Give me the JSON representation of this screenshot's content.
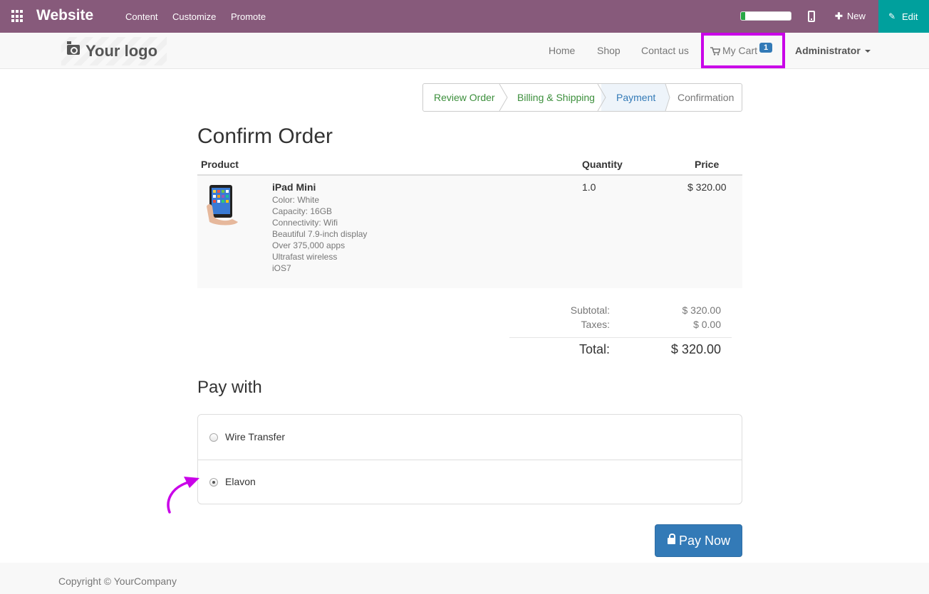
{
  "topbar": {
    "brand": "Website",
    "menu": [
      "Content",
      "Customize",
      "Promote"
    ],
    "progress_fraction": 0.08,
    "new_label": "New",
    "edit_label": "Edit",
    "bg_color": "#875A7B",
    "edit_color": "#00A09D",
    "icons": [
      "apps-grid-icon",
      "mobile-icon",
      "plus-icon",
      "pencil-icon"
    ]
  },
  "header": {
    "logo_text": "Your logo",
    "nav": [
      "Home",
      "Shop",
      "Contact us"
    ],
    "cart_label": "My Cart",
    "cart_count": "1",
    "user_menu": "Administrator",
    "highlight_color": "#c902e8",
    "icons": [
      "camera-icon",
      "cart-icon",
      "caret-down-icon"
    ]
  },
  "wizard": {
    "steps": [
      "Review Order",
      "Billing & Shipping",
      "Payment",
      "Confirmation"
    ],
    "active_index": 2,
    "done_color": "#3c8f3c",
    "active_color": "#337ab7",
    "pending_color": "#777777"
  },
  "order": {
    "title": "Confirm Order",
    "columns": [
      "Product",
      "Quantity",
      "Price"
    ],
    "items": [
      {
        "name": "iPad Mini",
        "attributes": [
          "Color: White",
          "Capacity: 16GB",
          "Connectivity: Wifi",
          "Beautiful 7.9-inch display",
          "Over 375,000 apps",
          "Ultrafast wireless",
          "iOS7"
        ],
        "quantity": "1.0",
        "price": "$ 320.00"
      }
    ],
    "subtotal_label": "Subtotal:",
    "subtotal": "$ 320.00",
    "taxes_label": "Taxes:",
    "taxes": "$ 0.00",
    "total_label": "Total:",
    "total": "$ 320.00"
  },
  "payment": {
    "title": "Pay with",
    "methods": [
      {
        "label": "Wire Transfer",
        "selected": false
      },
      {
        "label": "Elavon",
        "selected": true
      }
    ],
    "pay_button": "Pay Now",
    "button_color": "#337ab7",
    "annotation_color": "#c902e8"
  },
  "footer": {
    "copyright": "Copyright © YourCompany"
  }
}
